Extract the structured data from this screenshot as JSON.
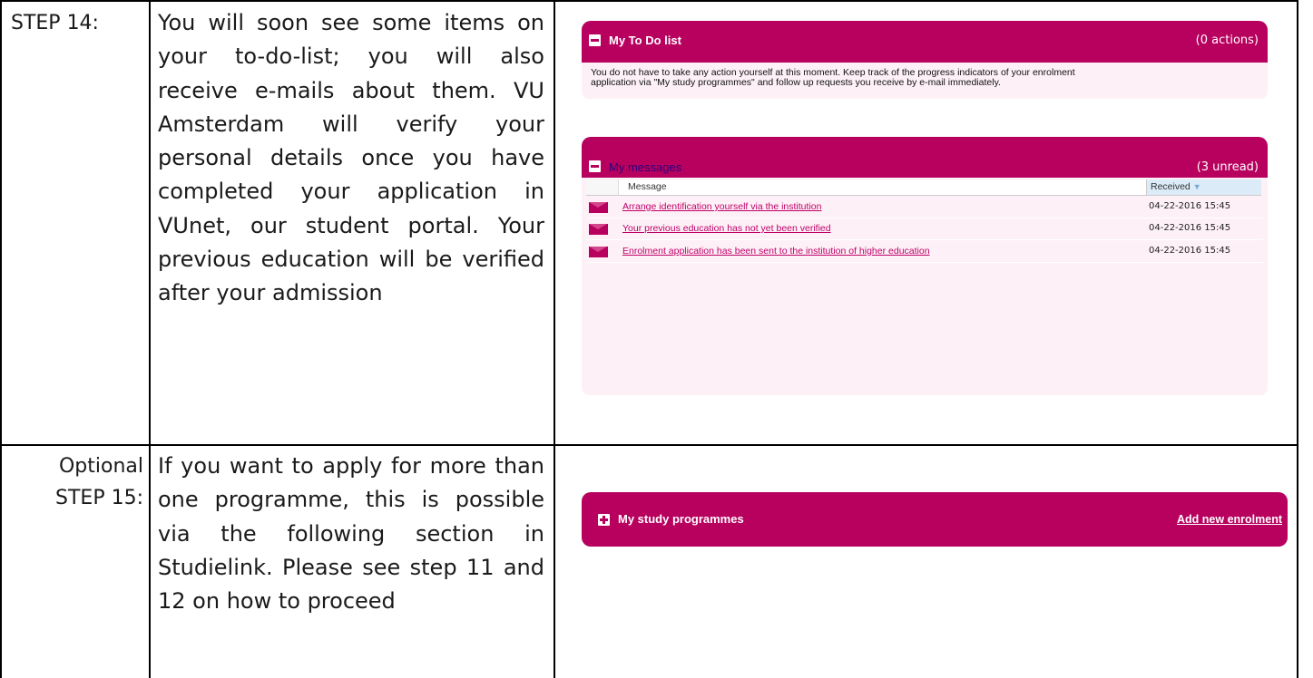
{
  "rows": [
    {
      "label_line1": "STEP 14:",
      "label_line2": "",
      "text": "You will soon see some items on your to-do-list; you will also receive e-mails about them. VU Amsterdam will verify your personal details once you have completed your application in VUnet, our student portal. Your previous education will be verified after your admission"
    },
    {
      "label_line1": "Optional",
      "label_line2": "STEP 15:",
      "text": "If you want to apply for more than one programme, this is possible via the following section in Studielink. Please see step 11 and 12 on how to proceed"
    }
  ],
  "todo": {
    "title": "My To Do list",
    "count": "(0 actions)",
    "body": "You do not have to take any action yourself at this moment. Keep track of the progress indicators of your enrolment application via \"My study programmes\" and follow up requests you receive by e-mail immediately."
  },
  "messages": {
    "title": "My messages",
    "count": "(3 unread)",
    "col_message": "Message",
    "col_received": "Received",
    "sort_icon": "sort-desc-icon",
    "items": [
      {
        "subject": "Arrange identification yourself via the institution",
        "date": "04-22-2016 15:45"
      },
      {
        "subject": "Your previous education has not yet been verified",
        "date": "04-22-2016 15:45"
      },
      {
        "subject": "Enrolment application has been sent to the institution of higher education",
        "date": "04-22-2016 15:45"
      }
    ]
  },
  "programmes": {
    "title": "My study programmes",
    "add_link": "Add new enrolment"
  },
  "colors": {
    "brand": "#b8005e",
    "panel_bg": "#fdf0f6",
    "link": "#c0006a",
    "title_dark": "#2a0080"
  }
}
